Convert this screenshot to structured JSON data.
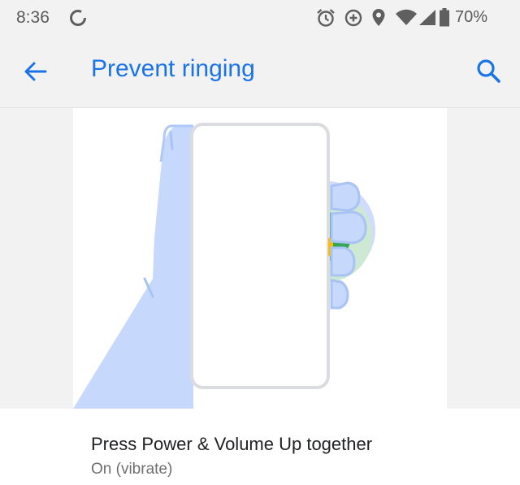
{
  "status_bar": {
    "time": "8:36",
    "battery": "70%",
    "icons": [
      "sync-icon",
      "alarm-icon",
      "data-saver-icon",
      "location-icon",
      "wifi-icon",
      "signal-icon",
      "battery-icon"
    ]
  },
  "app_bar": {
    "title": "Prevent ringing",
    "back_icon": "arrow-back-icon",
    "search_icon": "search-icon",
    "accent": "#1a73e8"
  },
  "setting": {
    "title": "Press Power & Volume Up together",
    "summary": "On (vibrate)"
  }
}
